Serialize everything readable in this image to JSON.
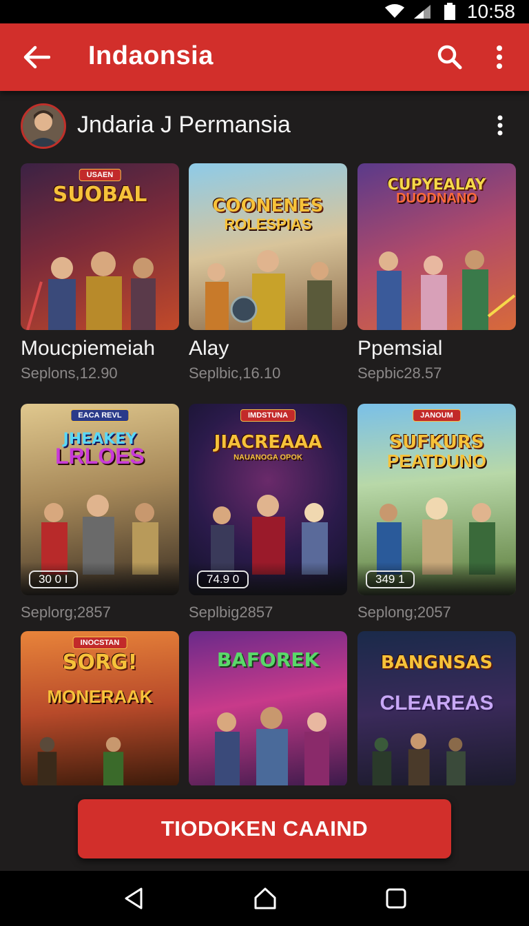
{
  "status_bar": {
    "time": "10:58",
    "icons": [
      "wifi-icon",
      "signal-icon",
      "battery-icon"
    ]
  },
  "app_bar": {
    "title": "Indaonsia",
    "back_icon": "arrow-left-icon",
    "search_icon": "search-icon",
    "more_icon": "more-vertical-icon"
  },
  "profile": {
    "name": "Jndaria J Permansia",
    "more_icon": "more-vertical-icon"
  },
  "games": [
    {
      "name": "Moucpiemeiah",
      "meta": "Seplons,12.90",
      "logo": "SUOBAL",
      "logo_sub": "",
      "chip": "USAEN",
      "badge": "",
      "colors": {
        "bg1": "#3b2244",
        "bg2": "#c24a2a",
        "accent": "#f6c23a"
      }
    },
    {
      "name": "Alay",
      "meta": "Seplbic,16.10",
      "logo": "COONENES",
      "logo_sub": "ROLESPIAS",
      "chip": "",
      "badge": "",
      "colors": {
        "bg1": "#6fb3d8",
        "bg2": "#b58a5a",
        "accent": "#f6c23a"
      }
    },
    {
      "name": "Ppemsial",
      "meta": "Sepbic28.57",
      "logo": "CUPYEALAY",
      "logo_sub": "DUODNANO",
      "chip": "",
      "badge": "",
      "colors": {
        "bg1": "#6a3a7a",
        "bg2": "#d86a3a",
        "accent": "#f6d84a"
      }
    },
    {
      "name": "",
      "meta": "Seplorg;2857",
      "logo": "JHEAKEY",
      "logo_sub": "LRLOES",
      "chip": "EACA REVL",
      "badge": "30 0 I",
      "colors": {
        "bg1": "#d8c08a",
        "bg2": "#4a3a2a",
        "accent": "#f6c23a"
      }
    },
    {
      "name": "",
      "meta": "Seplbig2857",
      "logo": "JIACREAAA",
      "logo_sub": "NAUANOGA OPOK",
      "chip": "IMDSTUNA",
      "badge": "74.9 0",
      "colors": {
        "bg1": "#1a1a3a",
        "bg2": "#6a1a2a",
        "accent": "#f6c23a"
      }
    },
    {
      "name": "",
      "meta": "Seplong;2057",
      "logo": "SUFKURS",
      "logo_sub": "PEATDUNO",
      "chip": "JANOUM",
      "badge": "349 1",
      "colors": {
        "bg1": "#6ab0d8",
        "bg2": "#5a7a3a",
        "accent": "#f6c23a"
      }
    },
    {
      "name": "",
      "meta": "",
      "logo": "SORG!",
      "logo_sub": "MONERAAK",
      "chip": "INOCSTAN",
      "badge": "",
      "colors": {
        "bg1": "#d8642a",
        "bg2": "#3a1a0a",
        "accent": "#f6d84a"
      }
    },
    {
      "name": "",
      "meta": "",
      "logo": "BAFOREK",
      "logo_sub": "",
      "chip": "",
      "badge": "",
      "colors": {
        "bg1": "#3a1a5a",
        "bg2": "#8a2a8a",
        "accent": "#5ad86a"
      }
    },
    {
      "name": "",
      "meta": "",
      "logo": "BANGNSAS",
      "logo_sub": "CLEAREAS",
      "chip": "",
      "badge": "",
      "colors": {
        "bg1": "#1a2a4a",
        "bg2": "#3a2a5a",
        "accent": "#f6c23a"
      }
    }
  ],
  "cta": {
    "label": "TIODOKEN CAAIND"
  },
  "nav_bar": {
    "icons": [
      "back-triangle-icon",
      "home-icon",
      "recents-square-icon"
    ]
  },
  "theme": {
    "primary": "#d22f2b",
    "background": "#1f1d1d"
  }
}
